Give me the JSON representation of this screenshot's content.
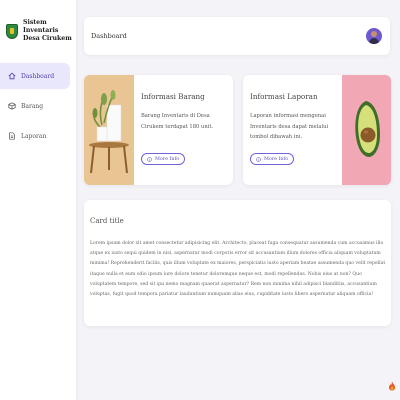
{
  "app": {
    "name": "Sistem Inventaris Desa Cirukem"
  },
  "sidebar": {
    "items": [
      {
        "label": "Dashboard",
        "icon": "home-icon",
        "active": true
      },
      {
        "label": "Barang",
        "icon": "box-icon",
        "active": false
      },
      {
        "label": "Laporan",
        "icon": "document-icon",
        "active": false
      }
    ]
  },
  "header": {
    "title": "Dashboard"
  },
  "cards": {
    "barang": {
      "title": "Informasi Barang",
      "text": "Barang Inventaris di Desa Cirukem terdapat 180 unit.",
      "button": "More Info"
    },
    "laporan": {
      "title": "Informasi Laporan",
      "text": "Laporan informasi mengenai Inventaris desa dapat melalui tombol dibawah ini.",
      "button": "More Info"
    },
    "main": {
      "title": "Card title",
      "text": "Lorem ipsum dolor sit amet consectetur adipisicing elit. Architecto, placeat fuga consequatur assumenda cum accusamus illo atque ex iusto sequi quidem in nisi, aspernatur modi corporis error sit accusantium illum dolores officia aliquam voluptatum minima! Reprehenderit facilis, quis illum voluptate ex maiores, perspiciatis iusto aperiam beatae assumenda quo velit repellat itaque nulla et eum odio ipsum iure dolore tenetur doloremque neque est, modi repellendus. Nobis eius at non? Quo voluptatem tempore, sed sit qui nemo magnam quaerat aspernatur? Rem non minima nihil adipisci blanditiis, accusantium voluptas, fugit quod tempora pariatur laudantium numquam alias eius, cupiditate iusto libero aspernatur aliquam officia!"
    }
  },
  "colors": {
    "accent": "#6f63d9",
    "active_bg": "#e9e7fb",
    "background": "#f3f3f8"
  }
}
